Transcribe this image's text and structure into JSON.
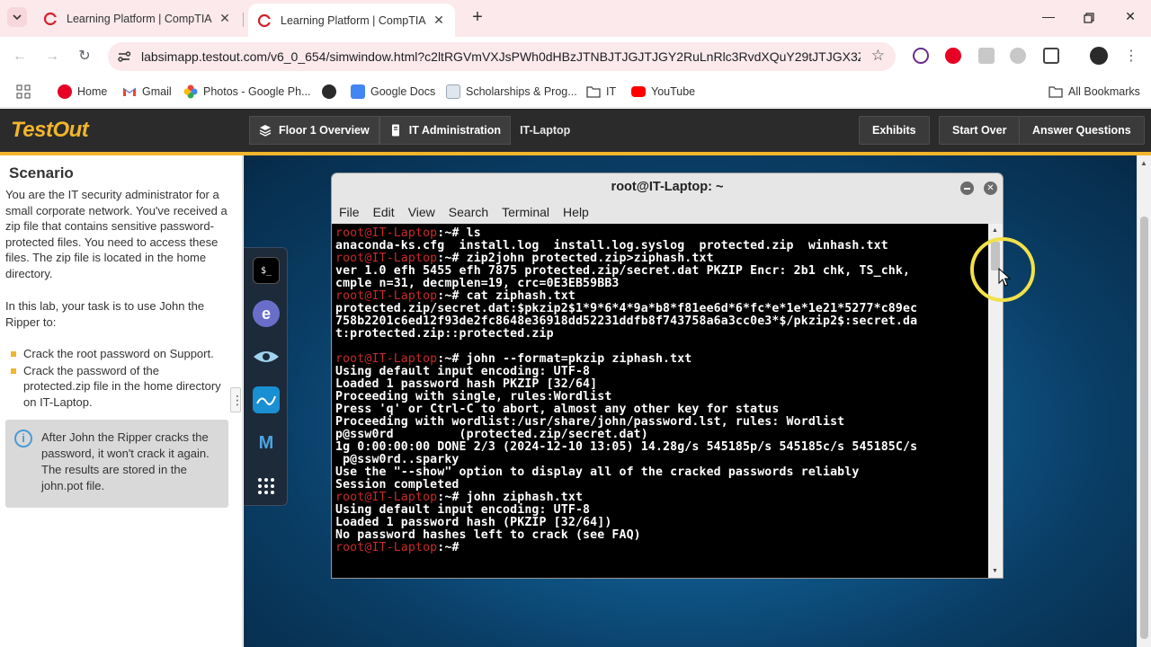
{
  "browser": {
    "tabs": [
      {
        "title": "Learning Platform | CompTIA",
        "active": false
      },
      {
        "title": "Learning Platform | CompTIA",
        "active": true
      }
    ],
    "url": "labsimapp.testout.com/v6_0_654/simwindow.html?c2ltRGVmVXJsPWh0dHBzJTNBJTJGJTJGY2RuLnRlc3RvdXQuY29tJTJGX3ZlcnN...",
    "bookmarks": [
      {
        "label": "Home",
        "icon": "pinterest-icon"
      },
      {
        "label": "Gmail",
        "icon": "gmail-icon"
      },
      {
        "label": "Photos - Google Ph...",
        "icon": "google-photos-icon"
      },
      {
        "label": "",
        "icon": "site-icon"
      },
      {
        "label": "Google Docs",
        "icon": "google-docs-icon"
      },
      {
        "label": "Scholarships & Prog...",
        "icon": "page-icon"
      },
      {
        "label": "IT",
        "icon": "folder-icon"
      },
      {
        "label": "YouTube",
        "icon": "youtube-icon"
      }
    ],
    "all_bookmarks": "All Bookmarks"
  },
  "testout": {
    "logo": "TestOut",
    "breadcrumbs": [
      "Floor 1 Overview",
      "IT Administration",
      "IT-Laptop"
    ],
    "buttons": {
      "exhibits": "Exhibits",
      "start_over": "Start Over",
      "answer_questions": "Answer Questions"
    }
  },
  "scenario": {
    "title": "Scenario",
    "intro": "You are the IT security administrator for a small corporate network. You've received a zip file that contains sensitive password-protected files. You need to access these files. The zip file is located in the home directory.",
    "task": "In this lab, your task is to use John the Ripper to:",
    "tasks": [
      "Crack the root password on Support.",
      "Crack the password of the protected.zip file in the home directory on IT-Laptop."
    ],
    "note": "After John the Ripper cracks the password, it won't crack it again. The results are stored in the john.pot file."
  },
  "terminal": {
    "title": "root@IT-Laptop: ~",
    "menu": [
      "File",
      "Edit",
      "View",
      "Search",
      "Terminal",
      "Help"
    ],
    "lines": [
      {
        "prompt": "root@IT-Laptop",
        "text": ":~# ls"
      },
      {
        "prompt": "",
        "text": "anaconda-ks.cfg  install.log  install.log.syslog  protected.zip  winhash.txt"
      },
      {
        "prompt": "root@IT-Laptop",
        "text": ":~# zip2john protected.zip>ziphash.txt"
      },
      {
        "prompt": "",
        "text": "ver 1.0 efh 5455 efh 7875 protected.zip/secret.dat PKZIP Encr: 2b1 chk, TS_chk,"
      },
      {
        "prompt": "",
        "text": "cmple n=31, decmplen=19, crc=0E3EB59BB3"
      },
      {
        "prompt": "root@IT-Laptop",
        "text": ":~# cat ziphash.txt"
      },
      {
        "prompt": "",
        "text": "protected.zip/secret.dat:$pkzip2$1*9*6*4*9a*b8*f81ee6d*6*fc*e*1e*1e21*5277*c89ec"
      },
      {
        "prompt": "",
        "text": "758b2201c6ed12f93de2fc8648e36918dd52231ddfb8f743758a6a3cc0e3*$/pkzip2$:secret.da"
      },
      {
        "prompt": "",
        "text": "t:protected.zip::protected.zip"
      },
      {
        "prompt": "",
        "text": ""
      },
      {
        "prompt": "root@IT-Laptop",
        "text": ":~# john --format=pkzip ziphash.txt"
      },
      {
        "prompt": "",
        "text": "Using default input encoding: UTF-8"
      },
      {
        "prompt": "",
        "text": "Loaded 1 password hash PKZIP [32/64]"
      },
      {
        "prompt": "",
        "text": "Proceeding with single, rules:Wordlist"
      },
      {
        "prompt": "",
        "text": "Press 'q' or Ctrl-C to abort, almost any other key for status"
      },
      {
        "prompt": "",
        "text": "Proceeding with wordlist:/usr/share/john/password.lst, rules: Wordlist"
      },
      {
        "prompt": "",
        "text": "p@ssw0rd         (protected.zip/secret.dat)"
      },
      {
        "prompt": "",
        "text": "1g 0:00:00:00 DONE 2/3 (2024-12-10 13:05) 14.28g/s 545185p/s 545185c/s 545185C/s"
      },
      {
        "prompt": "",
        "text": " p@ssw0rd..sparky"
      },
      {
        "prompt": "",
        "text": "Use the \"--show\" option to display all of the cracked passwords reliably"
      },
      {
        "prompt": "",
        "text": "Session completed"
      },
      {
        "prompt": "root@IT-Laptop",
        "text": ":~# john ziphash.txt"
      },
      {
        "prompt": "",
        "text": "Using default input encoding: UTF-8"
      },
      {
        "prompt": "",
        "text": "Loaded 1 password hash (PKZIP [32/64])"
      },
      {
        "prompt": "",
        "text": "No password hashes left to crack (see FAQ)"
      },
      {
        "prompt": "root@IT-Laptop",
        "text": ":~#"
      }
    ]
  },
  "colors": {
    "accent": "#f2b52b",
    "prompt": "#c92a2a",
    "header_bg": "#2b2b2b",
    "tab_bg": "#fbe9ec"
  }
}
